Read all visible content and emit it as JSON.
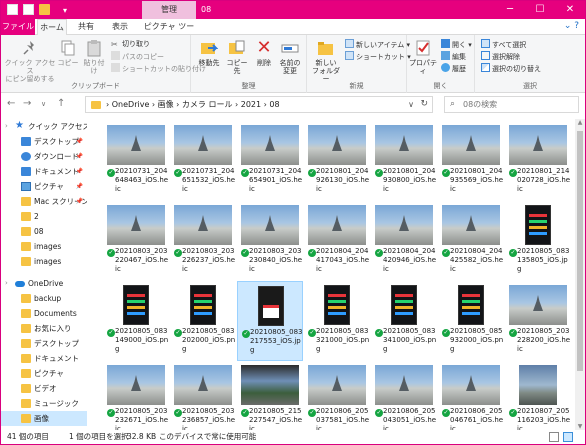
{
  "titlebar": {
    "context_tab_group": "管理",
    "title": "08",
    "controls": {
      "minimize": "─",
      "maximize": "☐",
      "close": "✕"
    }
  },
  "tabs": {
    "file": "ファイル",
    "home": "ホーム",
    "share": "共有",
    "view": "表示",
    "picture_tools": "ピクチャ ツール"
  },
  "ribbon": {
    "clipboard": {
      "label": "クリップボード",
      "pin": "クイック アクセス\nにピン留めする",
      "copy": "コピー",
      "paste": "貼り付け",
      "cut": "切り取り",
      "copy_path": "パスのコピー",
      "paste_shortcut": "ショートカットの貼り付け"
    },
    "organize": {
      "label": "整理",
      "move_to": "移動先",
      "copy_to": "コピー先",
      "delete": "削除",
      "rename": "名前の\n変更"
    },
    "new": {
      "label": "新規",
      "new_folder": "新しい\nフォルダー",
      "new_item": "新しいアイテム",
      "easy_access": "ショートカット"
    },
    "open": {
      "label": "開く",
      "properties": "プロパティ",
      "open": "開く",
      "edit": "編集",
      "history": "履歴"
    },
    "select": {
      "label": "選択",
      "select_all": "すべて選択",
      "select_none": "選択解除",
      "invert": "選択の切り替え"
    }
  },
  "address": {
    "path": "›  OneDrive  ›  画像  ›  カメラ ロール  ›  2021  ›  08",
    "search_placeholder": "08の検索"
  },
  "nav": {
    "items": [
      {
        "label": "クイック アクセス",
        "icon": "star-icon",
        "pinned": false,
        "level": 0
      },
      {
        "label": "デスクトップ",
        "icon": "desktop-icon",
        "pinned": true,
        "level": 1
      },
      {
        "label": "ダウンロード",
        "icon": "download-icon",
        "pinned": true,
        "level": 1
      },
      {
        "label": "ドキュメント",
        "icon": "documents-icon",
        "pinned": true,
        "level": 1
      },
      {
        "label": "ピクチャ",
        "icon": "pictures-icon",
        "pinned": true,
        "level": 1
      },
      {
        "label": "Mac スクリーン",
        "icon": "folder-icon",
        "pinned": true,
        "level": 1
      },
      {
        "label": "2",
        "icon": "folder-icon",
        "pinned": false,
        "level": 1
      },
      {
        "label": "08",
        "icon": "folder-icon",
        "pinned": false,
        "level": 1
      },
      {
        "label": "images",
        "icon": "folder-icon",
        "pinned": false,
        "level": 1
      },
      {
        "label": "images",
        "icon": "folder-icon",
        "pinned": false,
        "level": 1
      },
      {
        "label": "OneDrive",
        "icon": "cloud-icon",
        "pinned": false,
        "level": 0
      },
      {
        "label": "backup",
        "icon": "folder-icon",
        "pinned": false,
        "level": 1
      },
      {
        "label": "Documents",
        "icon": "folder-icon",
        "pinned": false,
        "level": 1
      },
      {
        "label": "お気に入り",
        "icon": "folder-icon",
        "pinned": false,
        "level": 1
      },
      {
        "label": "デスクトップ",
        "icon": "folder-icon",
        "pinned": false,
        "level": 1
      },
      {
        "label": "ドキュメント",
        "icon": "folder-icon",
        "pinned": false,
        "level": 1
      },
      {
        "label": "ピクチャ",
        "icon": "folder-icon",
        "pinned": false,
        "level": 1
      },
      {
        "label": "ビデオ",
        "icon": "folder-icon",
        "pinned": false,
        "level": 1
      },
      {
        "label": "ミュージック",
        "icon": "folder-icon",
        "pinned": false,
        "level": 1
      },
      {
        "label": "画像",
        "icon": "folder-icon",
        "pinned": false,
        "level": 1,
        "selected": true
      }
    ]
  },
  "files": [
    {
      "name": "20210731_204648463_iOS.heic",
      "thumb": "landscape"
    },
    {
      "name": "20210731_204651532_iOS.heic",
      "thumb": "landscape"
    },
    {
      "name": "20210731_204654901_iOS.heic",
      "thumb": "landscape"
    },
    {
      "name": "20210801_204926130_iOS.heic",
      "thumb": "landscape"
    },
    {
      "name": "20210801_204930800_iOS.heic",
      "thumb": "landscape"
    },
    {
      "name": "20210801_204935569_iOS.heic",
      "thumb": "landscape"
    },
    {
      "name": "20210801_214020728_iOS.heic",
      "thumb": "landscape"
    },
    {
      "name": "20210803_203220467_iOS.heic",
      "thumb": "landscape"
    },
    {
      "name": "20210803_203226237_iOS.heic",
      "thumb": "landscape"
    },
    {
      "name": "20210803_203230840_iOS.heic",
      "thumb": "landscape"
    },
    {
      "name": "20210804_204417043_iOS.heic",
      "thumb": "landscape"
    },
    {
      "name": "20210804_204420946_iOS.heic",
      "thumb": "landscape"
    },
    {
      "name": "20210804_204425582_iOS.heic",
      "thumb": "landscape"
    },
    {
      "name": "20210805_083135805_iOS.jpg",
      "thumb": "phone"
    },
    {
      "name": "20210805_083149000_iOS.png",
      "thumb": "phone"
    },
    {
      "name": "20210805_083202000_iOS.png",
      "thumb": "phone"
    },
    {
      "name": "20210805_083217553_iOS.jpg",
      "thumb": "phone-fit",
      "selected": true
    },
    {
      "name": "20210805_083321000_iOS.png",
      "thumb": "phone"
    },
    {
      "name": "20210805_083341000_iOS.png",
      "thumb": "phone"
    },
    {
      "name": "20210805_085932000_iOS.png",
      "thumb": "phone"
    },
    {
      "name": "20210805_203228200_iOS.heic",
      "thumb": "landscape"
    },
    {
      "name": "20210805_203232671_iOS.heic",
      "thumb": "landscape"
    },
    {
      "name": "20210805_203236857_iOS.heic",
      "thumb": "landscape"
    },
    {
      "name": "20210805_215227547_iOS.heic",
      "thumb": "mixed"
    },
    {
      "name": "20210806_205037581_iOS.heic",
      "thumb": "landscape"
    },
    {
      "name": "20210806_205043051_iOS.heic",
      "thumb": "landscape"
    },
    {
      "name": "20210806_205046761_iOS.heic",
      "thumb": "landscape"
    },
    {
      "name": "20210807_205116203_iOS.heic",
      "thumb": "port"
    }
  ],
  "status": {
    "item_count": "41 個の項目",
    "selected": "1 個の項目を選択",
    "size": "32.8 KB",
    "availability": "このデバイスで常に使用可能"
  },
  "colors": {
    "accent": "#e6007e",
    "selection": "#cce8ff",
    "sync_ok": "#15a542"
  }
}
